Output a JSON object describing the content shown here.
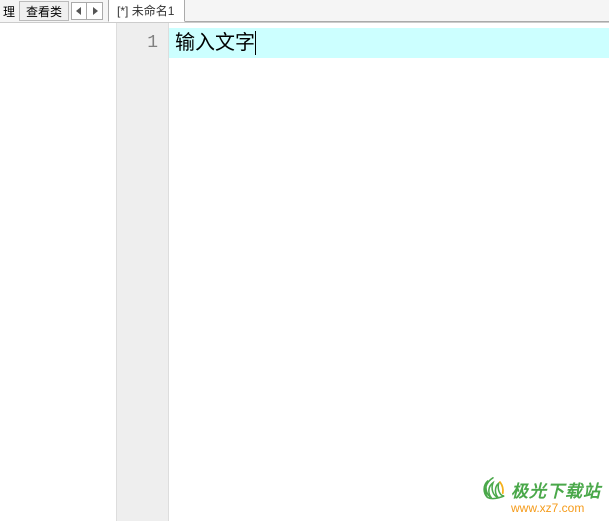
{
  "toolbar": {
    "left_label": "理",
    "view_class_button": "查看类"
  },
  "tabs": [
    {
      "label": "[*] 未命名1"
    }
  ],
  "editor": {
    "lines": [
      {
        "number": "1",
        "text": "输入文字"
      }
    ],
    "highlight_color": "#ccffff"
  },
  "watermark": {
    "title": "极光下载站",
    "url": "www.xz7.com",
    "title_color": "#4aa84a",
    "url_color": "#f59b1a"
  }
}
